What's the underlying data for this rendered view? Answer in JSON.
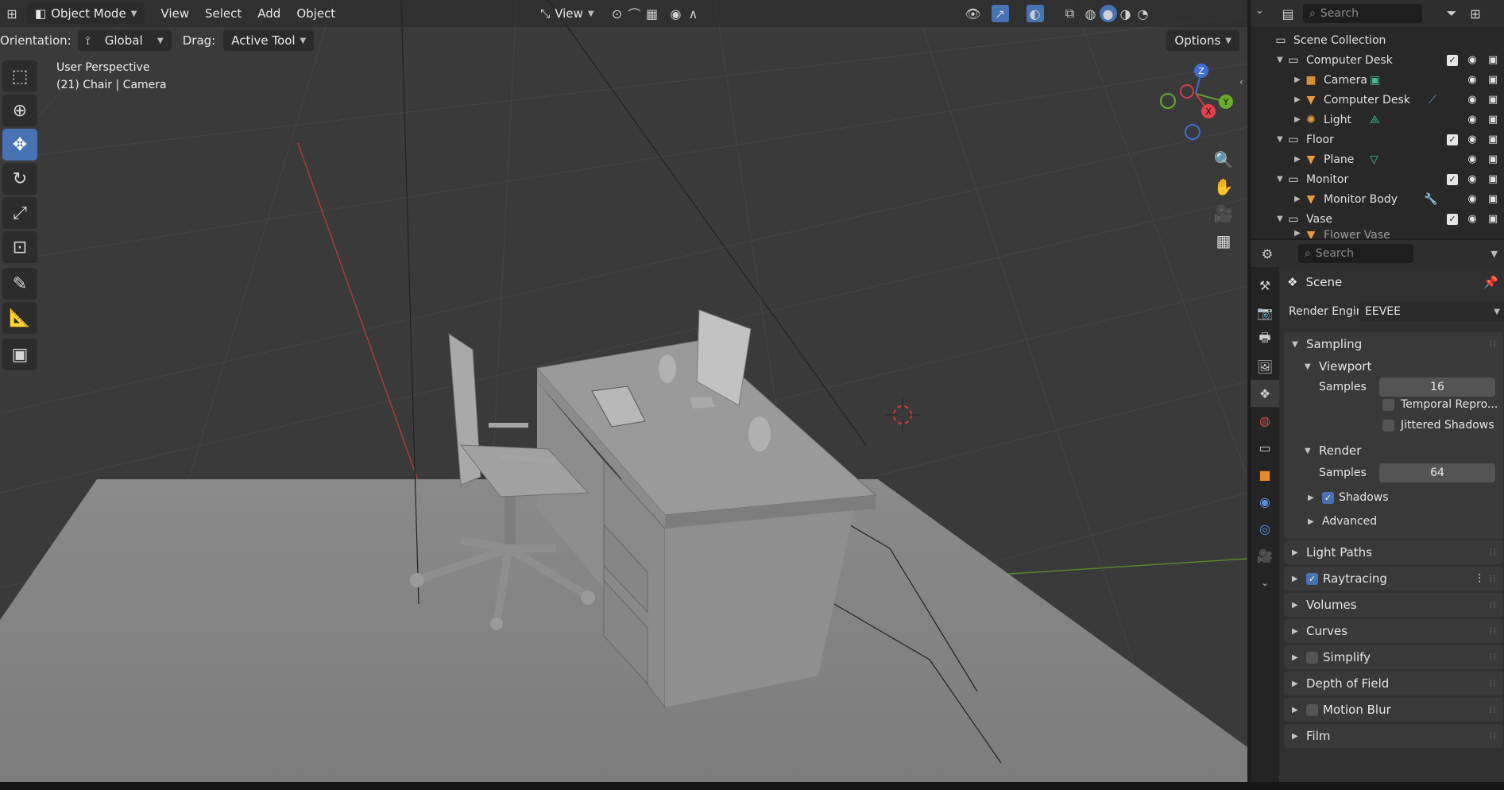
{
  "header": {
    "mode": "Object Mode",
    "menus": [
      "View",
      "Select",
      "Add",
      "Object"
    ],
    "view_label": "View",
    "orientation_label": "Orientation:",
    "orientation_value": "Global",
    "drag_label": "Drag:",
    "drag_value": "Active Tool",
    "options_label": "Options"
  },
  "viewport": {
    "title": "User Perspective",
    "subtitle": "(21) Chair | Camera",
    "gizmo": {
      "z": "Z",
      "y": "Y",
      "x": "X"
    }
  },
  "outliner": {
    "search_placeholder": "Search",
    "root": "Scene Collection",
    "rows": [
      {
        "label": "Computer Desk",
        "level": 1,
        "kind": "collection"
      },
      {
        "label": "Camera",
        "level": 2,
        "kind": "camera"
      },
      {
        "label": "Computer Desk",
        "level": 2,
        "kind": "mesh"
      },
      {
        "label": "Light",
        "level": 2,
        "kind": "light"
      },
      {
        "label": "Floor",
        "level": 1,
        "kind": "collection"
      },
      {
        "label": "Plane",
        "level": 2,
        "kind": "mesh"
      },
      {
        "label": "Monitor",
        "level": 1,
        "kind": "collection"
      },
      {
        "label": "Monitor Body",
        "level": 2,
        "kind": "mesh"
      },
      {
        "label": "Vase",
        "level": 1,
        "kind": "collection"
      },
      {
        "label": "Flower Vase",
        "level": 2,
        "kind": "mesh"
      }
    ]
  },
  "properties": {
    "search_placeholder": "Search",
    "context": "Scene",
    "render_engine_label": "Render Engine",
    "render_engine_value": "EEVEE",
    "sampling": {
      "title": "Sampling",
      "viewport_title": "Viewport",
      "viewport_samples_label": "Samples",
      "viewport_samples": "16",
      "temporal_label": "Temporal Repro...",
      "jittered_label": "Jittered Shadows",
      "render_title": "Render",
      "render_samples_label": "Samples",
      "render_samples": "64",
      "shadows_label": "Shadows",
      "advanced_label": "Advanced"
    },
    "panels": {
      "light_paths": "Light Paths",
      "raytracing": "Raytracing",
      "volumes": "Volumes",
      "curves": "Curves",
      "simplify": "Simplify",
      "dof": "Depth of Field",
      "motion_blur": "Motion Blur",
      "film": "Film"
    }
  }
}
